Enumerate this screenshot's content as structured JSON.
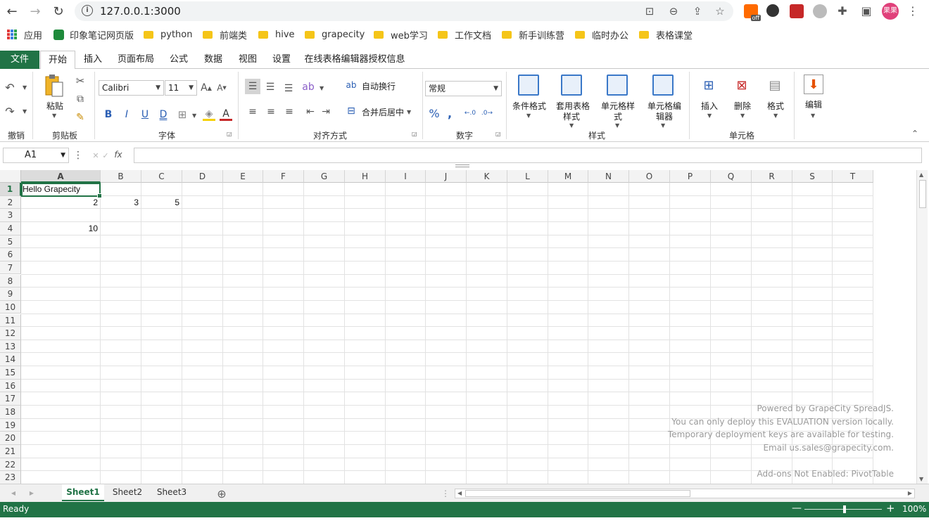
{
  "browser": {
    "url": "127.0.0.1:3000",
    "avatar_label": "果果",
    "ext_badge": "off",
    "bookmarks": [
      "应用",
      "印象笔记网页版",
      "python",
      "前端类",
      "hive",
      "grapecity",
      "web学习",
      "工作文档",
      "新手训练营",
      "临时办公",
      "表格课堂"
    ]
  },
  "ribbon": {
    "tabs": [
      "文件",
      "开始",
      "插入",
      "页面布局",
      "公式",
      "数据",
      "视图",
      "设置",
      "在线表格编辑器授权信息"
    ],
    "active_tab": "开始",
    "groups": {
      "undo": "撤销",
      "clipboard": "剪贴板",
      "font": "字体",
      "align": "对齐方式",
      "number": "数字",
      "style": "样式",
      "cells": "单元格"
    },
    "paste": "粘贴",
    "font_name": "Calibri",
    "font_size": "11",
    "bold": "B",
    "italic": "I",
    "underline": "U",
    "double_underline": "D",
    "wrap_text": "自动换行",
    "merge_center": "合并后居中",
    "number_format": "常规",
    "percent": "%",
    "comma": ",",
    "cond_format": "条件格式",
    "table_style_1": "套用表格",
    "table_style_2": "样式",
    "cell_style_1": "单元格样",
    "cell_style_2": "式",
    "cell_editor_1": "单元格编",
    "cell_editor_2": "辑器",
    "insert": "插入",
    "delete": "删除",
    "format": "格式",
    "edit": "编辑"
  },
  "formula_bar": {
    "name_box": "A1",
    "fx": "fx",
    "value": ""
  },
  "grid": {
    "columns": [
      "A",
      "B",
      "C",
      "D",
      "E",
      "F",
      "G",
      "H",
      "I",
      "J",
      "K",
      "L",
      "M",
      "N",
      "O",
      "P",
      "Q",
      "R",
      "S",
      "T"
    ],
    "rows": [
      "1",
      "2",
      "3",
      "4",
      "5",
      "6",
      "7",
      "8",
      "9",
      "10",
      "11",
      "12",
      "13",
      "14",
      "15",
      "16",
      "17",
      "18",
      "19",
      "20",
      "21",
      "22",
      "23"
    ],
    "cells": {
      "A1": "Hello Grapecity",
      "A2": "2",
      "B2": "3",
      "C2": "5",
      "A4": "10"
    },
    "watermark": [
      "Powered by GrapeCity SpreadJS.",
      "You can only deploy this EVALUATION version locally.",
      "Temporary deployment keys are available for testing.",
      "Email us.sales@grapecity.com.",
      "",
      "Add-ons Not Enabled: PivotTable"
    ]
  },
  "sheets": [
    "Sheet1",
    "Sheet2",
    "Sheet3"
  ],
  "active_sheet": "Sheet1",
  "status": {
    "text": "Ready",
    "zoom": "100%",
    "zoom_fraction": 0.5
  },
  "colors": {
    "accent": "#217346"
  }
}
